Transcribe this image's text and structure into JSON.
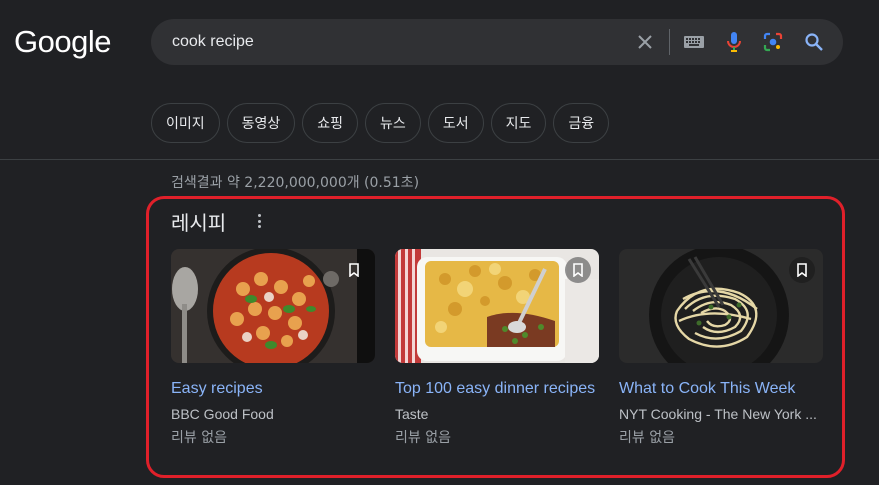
{
  "logo": "Google",
  "search": {
    "query": "cook recipe"
  },
  "icons": {
    "clear": "close-icon",
    "keyboard": "keyboard-icon",
    "voice": "microphone-icon",
    "lens": "camera-lens-icon",
    "search": "search-icon"
  },
  "chips": [
    "이미지",
    "동영상",
    "쇼핑",
    "뉴스",
    "도서",
    "지도",
    "금융"
  ],
  "stats": "검색결과 약 2,220,000,000개 (0.51초)",
  "recipes": {
    "title": "레시피",
    "cards": [
      {
        "title": "Easy recipes",
        "source": "BBC Good Food",
        "extra": "",
        "review": "리뷰 없음"
      },
      {
        "title": "Top 100 easy dinner recipes",
        "source": "Taste",
        "extra": "",
        "review": "리뷰 없음"
      },
      {
        "title": "What to Cook This Week",
        "source": "NYT Cooking - The New York ...",
        "extra": "",
        "review": "리뷰 없음"
      }
    ]
  },
  "colors": {
    "background": "#202124",
    "link": "#8ab4f8",
    "highlight_frame": "#e0202a"
  }
}
